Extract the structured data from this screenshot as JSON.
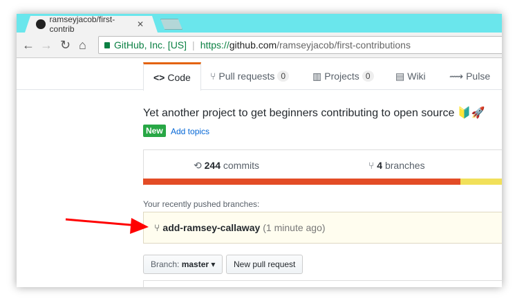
{
  "browser": {
    "tab_title": "ramseyjacob/first-contrib",
    "security_label": "GitHub, Inc. [US]",
    "url_scheme": "https://",
    "url_host": "github.com",
    "url_path": "/ramseyjacob/first-contributions"
  },
  "reponav": {
    "tabs": [
      {
        "label": "Code",
        "icon": "code-icon"
      },
      {
        "label": "Pull requests",
        "count": "0"
      },
      {
        "label": "Projects",
        "count": "0"
      },
      {
        "label": "Wiki"
      },
      {
        "label": "Pulse"
      }
    ]
  },
  "repo": {
    "description": "Yet another project to get beginners contributing to open source 🔰🚀",
    "new_badge": "New",
    "add_topics": "Add topics",
    "commits_count": "244",
    "commits_label": "commits",
    "branches_count": "4",
    "branches_label": "branches"
  },
  "languages": [
    {
      "pct": 85,
      "color": "#e34c26"
    },
    {
      "pct": 15,
      "color": "#f1e05a"
    }
  ],
  "recent": {
    "label": "Your recently pushed branches:",
    "branch": "add-ramsey-callaway",
    "ago": "(1 minute ago)"
  },
  "actions": {
    "branch_prefix": "Branch:",
    "branch_name": "master",
    "new_pr": "New pull request"
  }
}
